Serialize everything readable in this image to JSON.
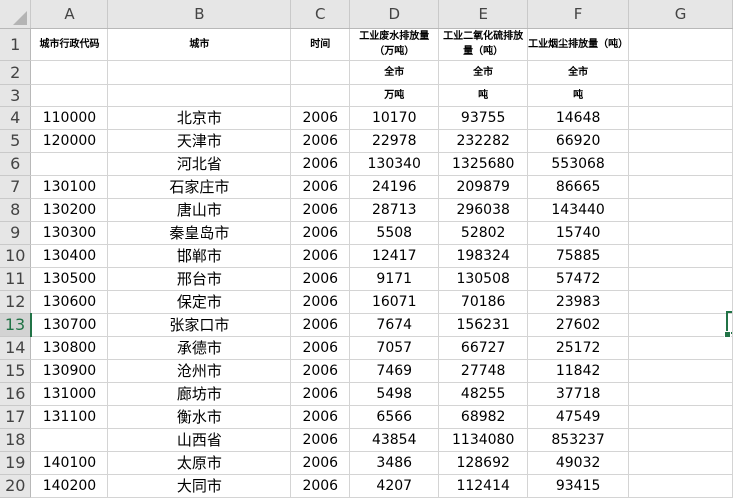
{
  "columns": [
    "A",
    "B",
    "C",
    "D",
    "E",
    "F",
    "G"
  ],
  "row_numbers": [
    "1",
    "2",
    "3",
    "4",
    "5",
    "6",
    "7",
    "8",
    "9",
    "10",
    "11",
    "12",
    "13",
    "14",
    "15",
    "16",
    "17",
    "18",
    "19",
    "20"
  ],
  "selected_row": "13",
  "header": {
    "row1": [
      "城市行政代码",
      "城市",
      "时间",
      "工业废水排放量（万吨）",
      "工业二氧化硫排放量（吨）",
      "工业烟尘排放量（吨）",
      ""
    ],
    "row2": [
      "",
      "",
      "",
      "全市",
      "全市",
      "全市",
      ""
    ],
    "row3": [
      "",
      "",
      "",
      "万吨",
      "吨",
      "吨",
      ""
    ]
  },
  "rows": [
    {
      "code": "110000",
      "city": "北京市",
      "year": "2006",
      "wastewater": "10170",
      "so2": "93755",
      "dust": "14648"
    },
    {
      "code": "120000",
      "city": "天津市",
      "year": "2006",
      "wastewater": "22978",
      "so2": "232282",
      "dust": "66920"
    },
    {
      "code": "",
      "city": "河北省",
      "year": "2006",
      "wastewater": "130340",
      "so2": "1325680",
      "dust": "553068"
    },
    {
      "code": "130100",
      "city": "石家庄市",
      "year": "2006",
      "wastewater": "24196",
      "so2": "209879",
      "dust": "86665"
    },
    {
      "code": "130200",
      "city": "唐山市",
      "year": "2006",
      "wastewater": "28713",
      "so2": "296038",
      "dust": "143440"
    },
    {
      "code": "130300",
      "city": "秦皇岛市",
      "year": "2006",
      "wastewater": "5508",
      "so2": "52802",
      "dust": "15740"
    },
    {
      "code": "130400",
      "city": "邯郸市",
      "year": "2006",
      "wastewater": "12417",
      "so2": "198324",
      "dust": "75885"
    },
    {
      "code": "130500",
      "city": "邢台市",
      "year": "2006",
      "wastewater": "9171",
      "so2": "130508",
      "dust": "57472"
    },
    {
      "code": "130600",
      "city": "保定市",
      "year": "2006",
      "wastewater": "16071",
      "so2": "70186",
      "dust": "23983"
    },
    {
      "code": "130700",
      "city": "张家口市",
      "year": "2006",
      "wastewater": "7674",
      "so2": "156231",
      "dust": "27602"
    },
    {
      "code": "130800",
      "city": "承德市",
      "year": "2006",
      "wastewater": "7057",
      "so2": "66727",
      "dust": "25172"
    },
    {
      "code": "130900",
      "city": "沧州市",
      "year": "2006",
      "wastewater": "7469",
      "so2": "27748",
      "dust": "11842"
    },
    {
      "code": "131000",
      "city": "廊坊市",
      "year": "2006",
      "wastewater": "5498",
      "so2": "48255",
      "dust": "37718"
    },
    {
      "code": "131100",
      "city": "衡水市",
      "year": "2006",
      "wastewater": "6566",
      "so2": "68982",
      "dust": "47549"
    },
    {
      "code": "",
      "city": "山西省",
      "year": "2006",
      "wastewater": "43854",
      "so2": "1134080",
      "dust": "853237"
    },
    {
      "code": "140100",
      "city": "太原市",
      "year": "2006",
      "wastewater": "3486",
      "so2": "128692",
      "dust": "49032"
    },
    {
      "code": "140200",
      "city": "大同市",
      "year": "2006",
      "wastewater": "4207",
      "so2": "112414",
      "dust": "93415"
    }
  ]
}
